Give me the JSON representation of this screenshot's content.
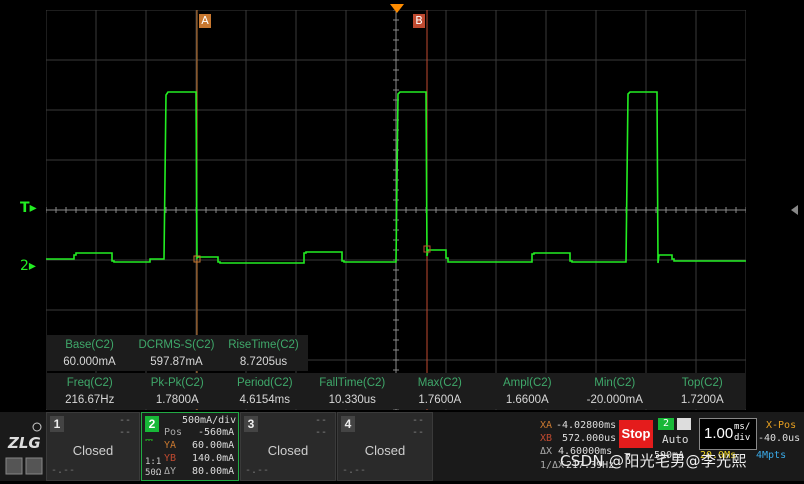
{
  "cursors": {
    "a_label": "A",
    "b_label": "B"
  },
  "trigger": {
    "label": "T"
  },
  "channel_marker": {
    "label": "2"
  },
  "measure_row1": [
    {
      "name": "Base(C2)",
      "value": "60.000mA"
    },
    {
      "name": "DCRMS-S(C2)",
      "value": "597.87mA"
    },
    {
      "name": "RiseTime(C2)",
      "value": "8.7205us"
    }
  ],
  "measure_row2": [
    {
      "name": "Freq(C2)",
      "value": "216.67Hz"
    },
    {
      "name": "Pk-Pk(C2)",
      "value": "1.7800A"
    },
    {
      "name": "Period(C2)",
      "value": "4.6154ms"
    },
    {
      "name": "FallTime(C2)",
      "value": "10.330us"
    },
    {
      "name": "Max(C2)",
      "value": "1.7600A"
    },
    {
      "name": "Ampl(C2)",
      "value": "1.6600A"
    },
    {
      "name": "Min(C2)",
      "value": "-20.000mA"
    },
    {
      "name": "Top(C2)",
      "value": "1.7200A"
    }
  ],
  "channels": {
    "ch1": {
      "num": "1",
      "status": "Closed",
      "dash1": "--",
      "dash2": "--",
      "foot": "-.--"
    },
    "ch2": {
      "num": "2",
      "scale": "500mA/div",
      "pos_label": "Pos",
      "pos": "-560mA",
      "ya_label": "YA",
      "ya": "60.00mA",
      "yb_label": "YB",
      "yb": "140.0mA",
      "dy_label": "ΔY",
      "dy": "80.00mA",
      "coupling": "1:1",
      "imp": "50Ω"
    },
    "ch3": {
      "num": "3",
      "status": "Closed",
      "dash1": "--",
      "dash2": "--",
      "foot": "-.--"
    },
    "ch4": {
      "num": "4",
      "status": "Closed",
      "dash1": "--",
      "dash2": "--",
      "foot": "-.--"
    }
  },
  "cursor_info": {
    "xa_label": "XA",
    "xa": "-4.02800ms",
    "xb_label": "XB",
    "xb": "572.000us",
    "dx_label": "ΔX",
    "dx": "4.60000ms",
    "inv_label": "1/ΔX",
    "inv": "217.39Hz"
  },
  "acquire": {
    "state": "Stop",
    "channel": "2",
    "mode": "Auto",
    "trig_level": "590mA"
  },
  "timebase": {
    "value": "1.00",
    "unit_top": "ms/",
    "unit_bottom": "div",
    "xpos_label": "X-Pos",
    "xpos": "-40.0us",
    "sample": "20.0Ms",
    "points": "4Mpts"
  },
  "watermark": "CSDN @阳光宅男@李光熙",
  "colors": {
    "ch2": "#22ee22",
    "cursor_a": "#c87830",
    "cursor_b": "#c04a30",
    "trigger": "#ff8c00",
    "stop": "#e41c1c"
  }
}
